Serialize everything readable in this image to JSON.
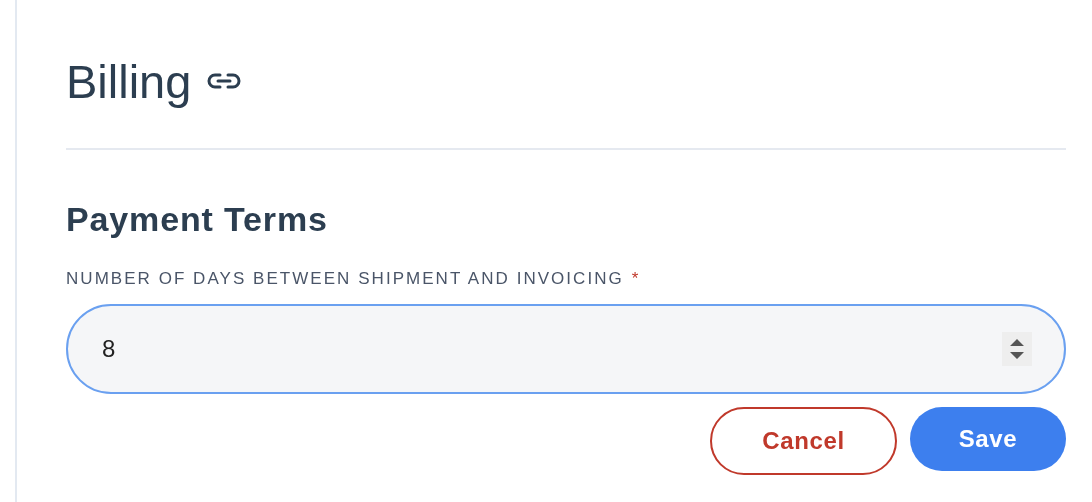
{
  "page": {
    "title": "Billing"
  },
  "section": {
    "title": "Payment Terms"
  },
  "field": {
    "label": "NUMBER OF DAYS BETWEEN SHIPMENT AND INVOICING",
    "required_mark": "*",
    "value": "8",
    "focused": true
  },
  "buttons": [
    {
      "label": "Cancel",
      "kind": "secondary"
    },
    {
      "label": "Save",
      "kind": "primary"
    }
  ]
}
